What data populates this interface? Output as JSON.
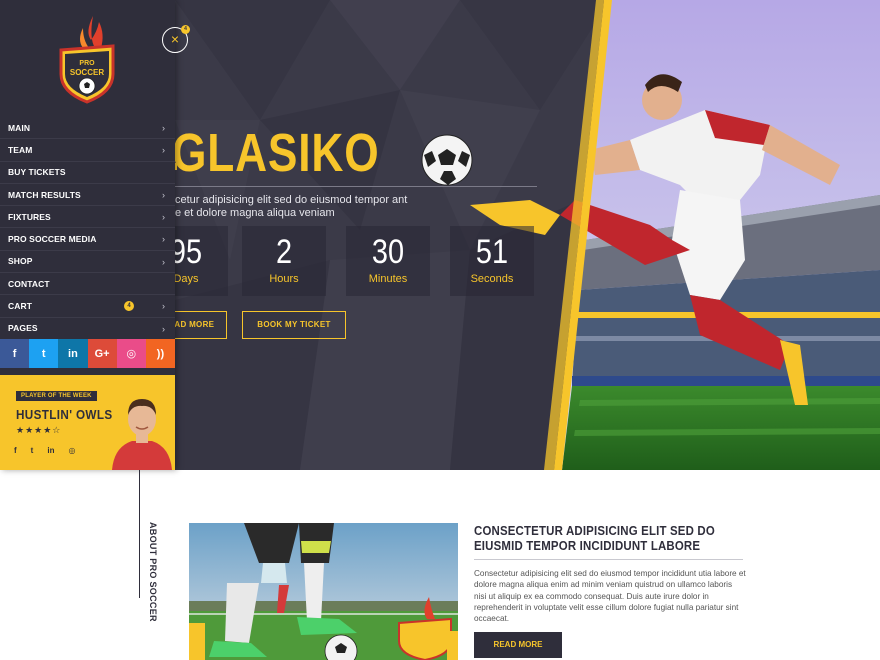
{
  "colors": {
    "accent": "#f7c52b",
    "dark": "#2f2e3b",
    "hero_bg": "#3b3a48"
  },
  "hero": {
    "title": "GLASIKO",
    "text": "cetur adipisicing elit sed do eiusmod tempor ant e et dolore magna aliqua veniam",
    "countdown": [
      {
        "value": "95",
        "label": "Days"
      },
      {
        "value": "2",
        "label": "Hours"
      },
      {
        "value": "30",
        "label": "Minutes"
      },
      {
        "value": "51",
        "label": "Seconds"
      }
    ],
    "read_more": "READ MORE",
    "book_ticket": "BOOK MY TICKET"
  },
  "logo": {
    "text_top": "PRO",
    "text_bottom": "SOCCER"
  },
  "close_badge": "4",
  "menu": [
    {
      "label": "MAIN",
      "arrow": true
    },
    {
      "label": "TEAM",
      "arrow": true
    },
    {
      "label": "BUY TICKETS",
      "arrow": false
    },
    {
      "label": "MATCH RESULTS",
      "arrow": true
    },
    {
      "label": "FIXTURES",
      "arrow": true
    },
    {
      "label": "PRO SOCCER MEDIA",
      "arrow": true
    },
    {
      "label": "SHOP",
      "arrow": true
    },
    {
      "label": "CONTACT",
      "arrow": false
    },
    {
      "label": "CART",
      "arrow": true,
      "badge": "4"
    },
    {
      "label": "PAGES",
      "arrow": true
    }
  ],
  "social": [
    {
      "icon": "facebook-icon",
      "glyph": "f",
      "color": "#3b5998"
    },
    {
      "icon": "twitter-icon",
      "glyph": "t",
      "color": "#1da1f2"
    },
    {
      "icon": "linkedin-icon",
      "glyph": "in",
      "color": "#0e76a8"
    },
    {
      "icon": "google-plus-icon",
      "glyph": "G+",
      "color": "#dd4b39"
    },
    {
      "icon": "dribbble-icon",
      "glyph": "◎",
      "color": "#ea4c89"
    },
    {
      "icon": "rss-icon",
      "glyph": "))",
      "color": "#f26522"
    }
  ],
  "player_of_week": {
    "tag": "PLAYER OF THE WEEK",
    "name": "HUSTLIN' OWLS",
    "rating": "★★★★☆",
    "social": [
      "f",
      "t",
      "in",
      "◎"
    ]
  },
  "about": {
    "vertical_label": "ABOUT PRO SOCCER",
    "heading": "CONSECTETUR ADIPISICING ELIT SED DO EIUSMID TEMPOR INCIDIDUNT LABORE",
    "text": "Consectetur adipisicing elit sed do eiusmod tempor incididunt utia labore et dolore magna aliqua enim ad minim veniam quistrud on ullamco laboris nisi ut aliquip ex ea commodo consequat. Duis aute irure dolor in reprehenderit in voluptate velit esse cillum dolore fugiat nulla pariatur sint occaecat.",
    "read_more": "READ MORE"
  }
}
